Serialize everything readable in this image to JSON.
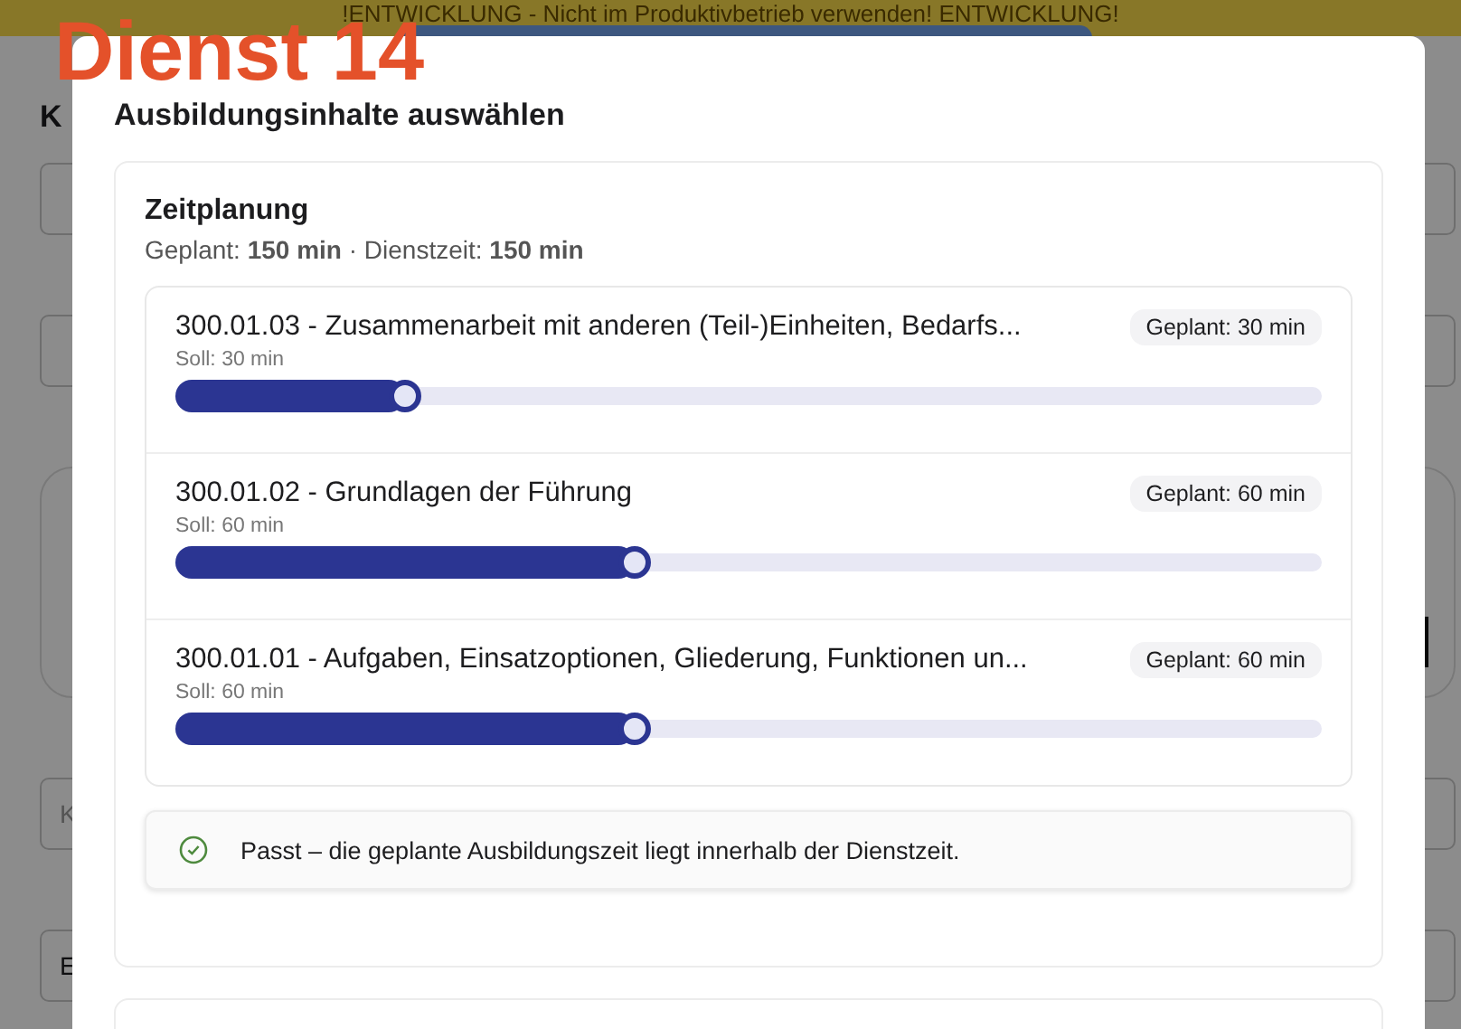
{
  "banner": {
    "text": "!ENTWICKLUNG - Nicht im Produktivbetrieb verwenden! ENTWICKLUNG!"
  },
  "overlay_label": "Dienst 14",
  "page": {
    "title": "K",
    "fields": [
      {
        "kind": "field"
      },
      {
        "kind": "field"
      },
      {
        "kind": "card"
      },
      {
        "kind": "field",
        "placeholder": "K"
      },
      {
        "kind": "field",
        "value": "E"
      }
    ]
  },
  "modal": {
    "title": "Ausbildungsinhalte auswählen",
    "section": {
      "title": "Zeitplanung",
      "summary": "Geplant: **150 min** · Dienstzeit: **150 min**",
      "items": [
        {
          "title": "300.01.03 - Zusammenarbeit mit anderen (Teil-)Einheiten, Bedarfs...",
          "target": "Soll: 30 min",
          "planned": "Geplant: 30 min",
          "level": 0.2
        },
        {
          "title": "300.01.02 - Grundlagen der Führung",
          "target": "Soll: 60 min",
          "planned": "Geplant: 60 min",
          "level": 0.4
        },
        {
          "title": "300.01.01 - Aufgaben, Einsatzoptionen, Gliederung, Funktionen un...",
          "target": "Soll: 60 min",
          "planned": "Geplant: 60 min",
          "level": 0.4
        }
      ],
      "status": {
        "ok": true,
        "text": "Passt – die geplante Ausbildungszeit liegt innerhalb der Dienstzeit."
      }
    }
  }
}
